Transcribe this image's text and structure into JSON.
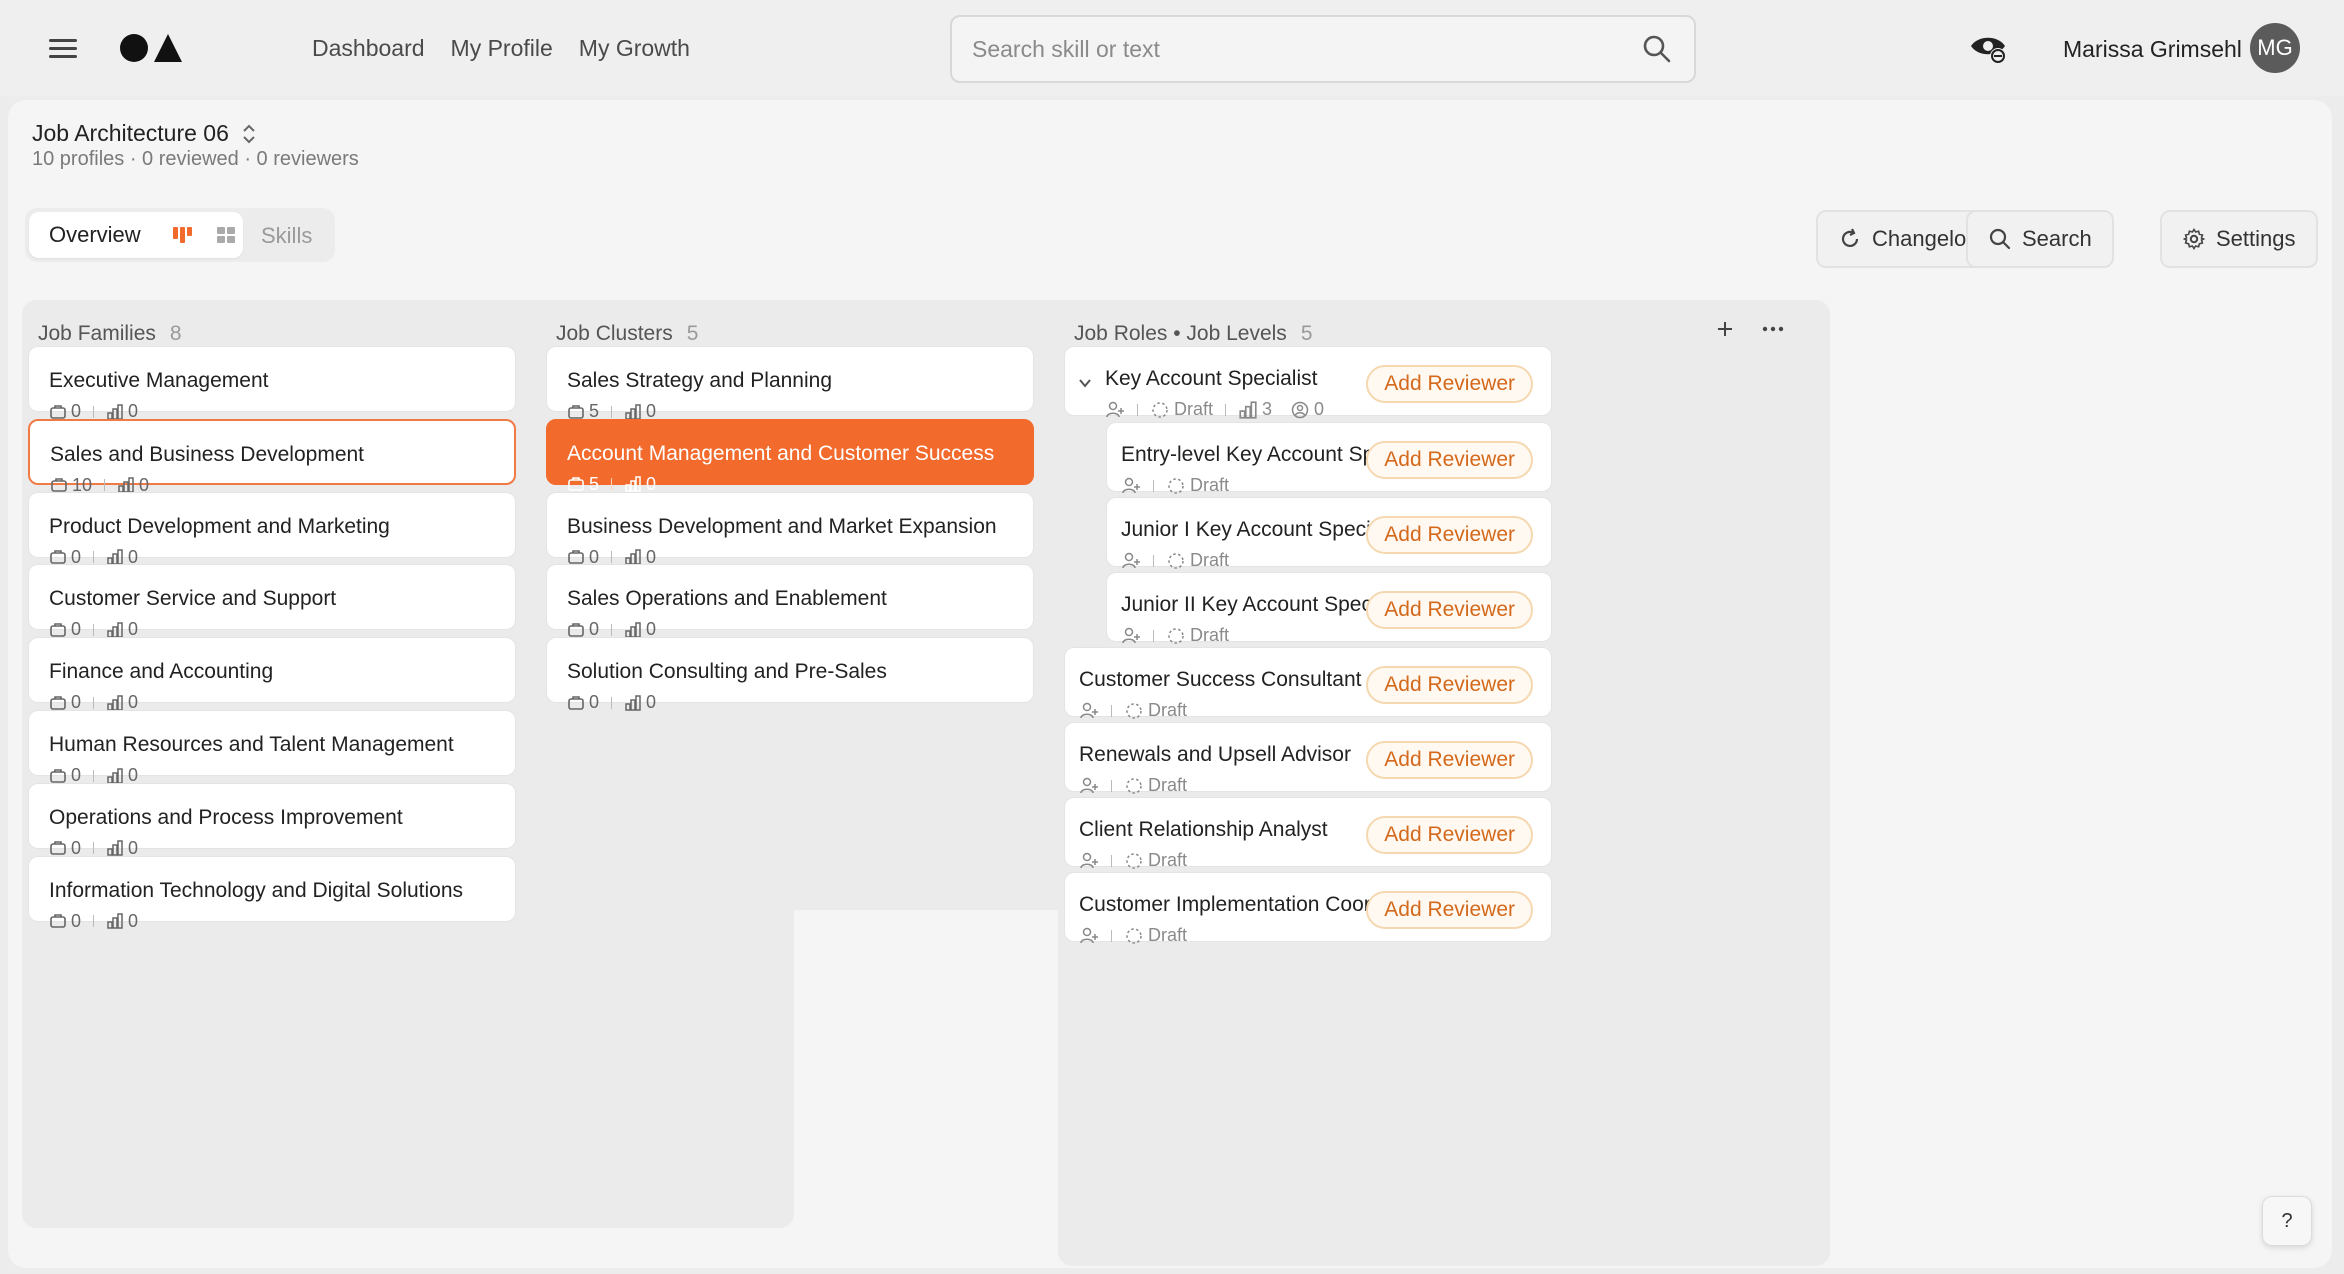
{
  "nav": {
    "menu_icon": "hamburger-icon",
    "links": [
      "Dashboard",
      "My Profile",
      "My Growth"
    ]
  },
  "search": {
    "placeholder": "Search skill or text"
  },
  "user": {
    "name": "Marissa Grimsehl",
    "initials": "MG"
  },
  "page": {
    "title": "Job Architecture 06",
    "meta": "10 profiles · 0 reviewed · 0 reviewers"
  },
  "view_toggle": {
    "overview": "Overview",
    "skills": "Skills"
  },
  "toolbar": {
    "changelog": "Changelog",
    "search": "Search",
    "settings": "Settings"
  },
  "colors": {
    "accent": "#f26a2c",
    "reviewer_text": "#d4691c",
    "dot": "#f08a55"
  },
  "families": {
    "title": "Job Families",
    "count": "8",
    "items": [
      {
        "name": "Executive Management",
        "a": "0",
        "b": "0"
      },
      {
        "name": "Sales and Business Development",
        "a": "10",
        "b": "0"
      },
      {
        "name": "Product Development and Marketing",
        "a": "0",
        "b": "0"
      },
      {
        "name": "Customer Service and Support",
        "a": "0",
        "b": "0"
      },
      {
        "name": "Finance and Accounting",
        "a": "0",
        "b": "0"
      },
      {
        "name": "Human Resources and Talent Management",
        "a": "0",
        "b": "0"
      },
      {
        "name": "Operations and Process Improvement",
        "a": "0",
        "b": "0"
      },
      {
        "name": "Information Technology and Digital Solutions",
        "a": "0",
        "b": "0"
      }
    ]
  },
  "clusters": {
    "title": "Job Clusters",
    "count": "5",
    "items": [
      {
        "name": "Sales Strategy and Planning",
        "a": "5",
        "b": "0"
      },
      {
        "name": "Account Management and Customer Success",
        "a": "5",
        "b": "0"
      },
      {
        "name": "Business Development and Market Expansion",
        "a": "0",
        "b": "0"
      },
      {
        "name": "Sales Operations and Enablement",
        "a": "0",
        "b": "0"
      },
      {
        "name": "Solution Consulting and Pre-Sales",
        "a": "0",
        "b": "0"
      }
    ]
  },
  "roles": {
    "title": "Job Roles • Job Levels",
    "count": "5",
    "add_reviewer": "Add Reviewer",
    "draft": "Draft",
    "parent": {
      "name": "Key Account Specialist",
      "levels": "3",
      "reviewers": "0"
    },
    "levels": [
      {
        "name": "Entry-level Key Account Specialist"
      },
      {
        "name": "Junior I Key Account Specialist"
      },
      {
        "name": "Junior II Key Account Specialist"
      }
    ],
    "items": [
      {
        "name": "Customer Success Consultant"
      },
      {
        "name": "Renewals and Upsell Advisor"
      },
      {
        "name": "Client Relationship Analyst"
      },
      {
        "name": "Customer Implementation Coordinator"
      }
    ]
  },
  "help": {
    "label": "?"
  }
}
